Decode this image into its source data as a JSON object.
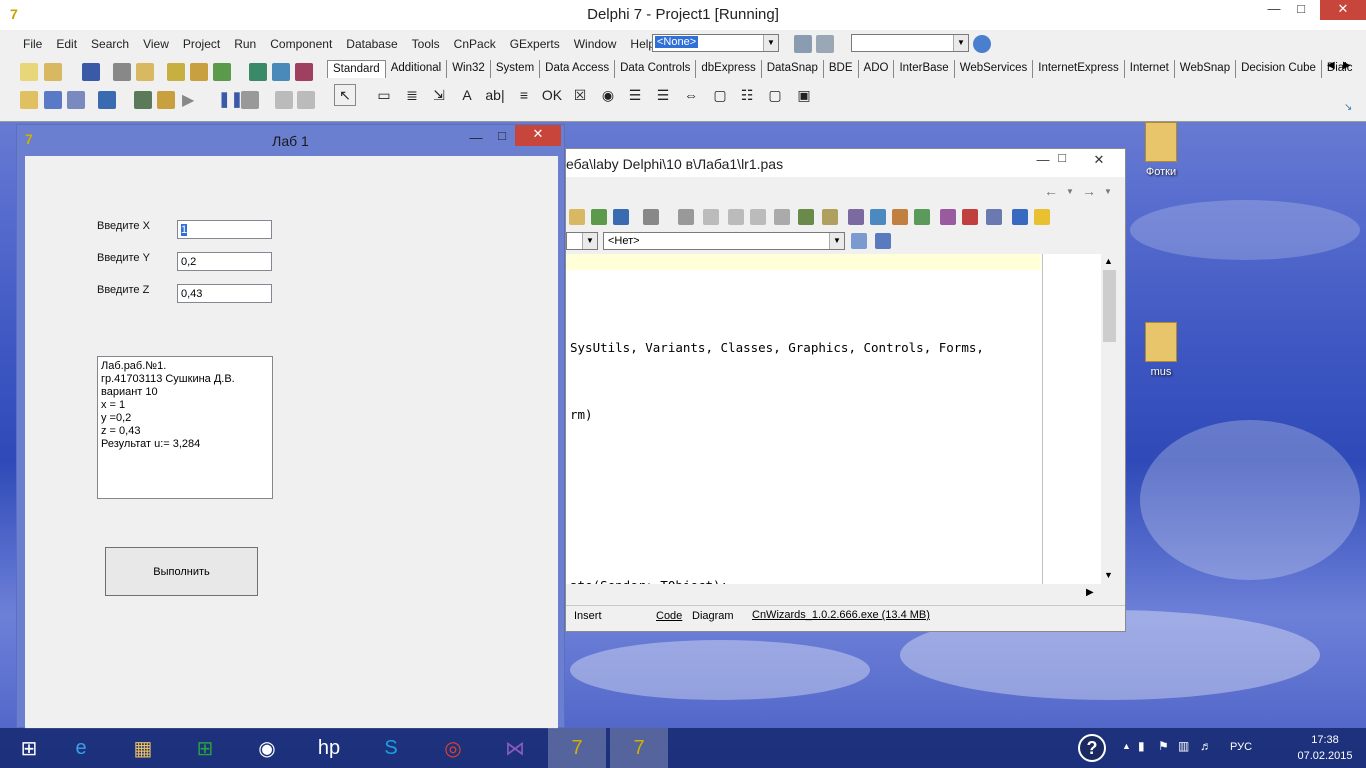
{
  "ide": {
    "title": "Delphi 7 - Project1 [Running]",
    "menu": [
      "File",
      "Edit",
      "Search",
      "View",
      "Project",
      "Run",
      "Component",
      "Database",
      "Tools",
      "CnPack",
      "GExperts",
      "Window",
      "Help"
    ],
    "combo_value": "<None>",
    "palette_tabs": [
      "Standard",
      "Additional",
      "Win32",
      "System",
      "Data Access",
      "Data Controls",
      "dbExpress",
      "DataSnap",
      "BDE",
      "ADO",
      "InterBase",
      "WebServices",
      "InternetExpress",
      "Internet",
      "WebSnap",
      "Decision Cube",
      "Dialc"
    ],
    "palette_icons": [
      "pointer-icon",
      "frame-icon",
      "mainmenu-icon",
      "popupmenu-icon",
      "label-icon",
      "edit-icon",
      "memo-icon",
      "button-icon",
      "checkbox-icon",
      "radiobutton-icon",
      "listbox-icon",
      "combobox-icon",
      "scrollbar-icon",
      "groupbox-icon",
      "radiogroup-icon",
      "panel-icon",
      "actionlist-icon"
    ],
    "palette_glyphs": [
      "↖",
      "▭",
      "≣",
      "⇲",
      "A",
      "ab|",
      "≡",
      "OK",
      "☒",
      "◉",
      "☰",
      "☰",
      "⇔",
      "▢",
      "☷",
      "▢",
      "▣"
    ]
  },
  "form": {
    "title": "Лаб 1",
    "label_x": "Введите X",
    "label_y": "Введите Y",
    "label_z": "Введите Z",
    "value_x": "1",
    "value_y": "0,2",
    "value_z": "0,43",
    "memo_lines": [
      "Лаб.раб.№1.",
      "гр.41703113 Сушкина Д.В.",
      "вариант 10",
      "x = 1",
      "y =0,2",
      "z = 0,43",
      "Результат u:= 3,284"
    ],
    "button_label": "Выполнить"
  },
  "editor": {
    "title": "еба\\laby Delphi\\10 в\\Лаба1\\lr1.pas",
    "combo_value": "<Нет>",
    "code_lines": [
      {
        "text": "SysUtils, Variants, Classes, Graphics, Controls, Forms,"
      },
      {
        "text": "rm)"
      },
      {
        "text": "ate(Sender: TObject);"
      }
    ],
    "status_mode": "Insert",
    "tab_code": "Code",
    "tab_diagram": "Diagram",
    "status_hint": "CnWizards_1.0.2.666.exe (13.4 MB)"
  },
  "desktop": {
    "icon1": "Фотки",
    "icon2": "mus"
  },
  "taskbar": {
    "apps": [
      "windows-start-icon",
      "internet-explorer-icon",
      "file-explorer-icon",
      "store-icon",
      "media-icon",
      "hp-icon",
      "skype-icon",
      "chrome-icon",
      "visual-studio-icon",
      "delphi7-icon",
      "delphi-project-icon"
    ],
    "glyphs": [
      "⊞",
      "e",
      "▦",
      "⊞",
      "◉",
      "hp",
      "S",
      "◎",
      "⋈",
      "7",
      "7"
    ],
    "lang": "РУС",
    "time": "17:38",
    "date": "07.02.2015"
  }
}
